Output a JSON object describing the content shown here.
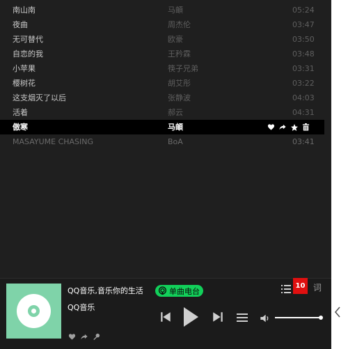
{
  "playlist": [
    {
      "title": "南山南",
      "artist": "马頔",
      "duration": "05:24"
    },
    {
      "title": "夜曲",
      "artist": "周杰伦",
      "duration": "03:47"
    },
    {
      "title": "无可替代",
      "artist": "欧豪",
      "duration": "03:50"
    },
    {
      "title": "自恋的我",
      "artist": "王矜霖",
      "duration": "03:48"
    },
    {
      "title": "小苹果",
      "artist": "筷子兄弟",
      "duration": "03:31"
    },
    {
      "title": "樱树花",
      "artist": "胡艾彤",
      "duration": "03:22"
    },
    {
      "title": "这支烟灭了以后",
      "artist": "张静波",
      "duration": "04:03"
    },
    {
      "title": "活着",
      "artist": "郝云",
      "duration": "04:31"
    },
    {
      "title": "傲寒",
      "artist": "马頔",
      "duration": ""
    },
    {
      "title": "MASAYUME CHASING",
      "artist": "BoA",
      "duration": "03:41"
    }
  ],
  "active_row_icons": [
    "heart-icon",
    "share-icon",
    "star-icon",
    "delete-icon"
  ],
  "player": {
    "song_title": "QQ音乐,音乐你的生活",
    "artist": "QQ音乐",
    "radio_label": "单曲电台",
    "queue_count": "10",
    "lyric_label": "词",
    "volume_level": 1.0
  },
  "colors": {
    "background": "#1f1f1f",
    "active_row": "#000000",
    "accent_green": "#12d05a",
    "badge_red": "#e01010",
    "cover": "#7fd3a9"
  }
}
